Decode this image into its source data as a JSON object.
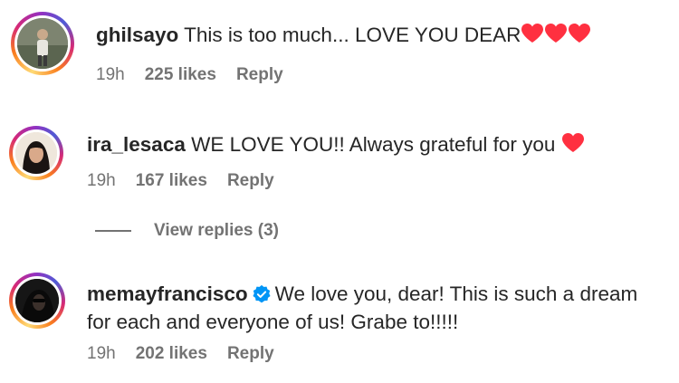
{
  "comments": [
    {
      "username": "ghilsayo",
      "text": "This is too much... LOVE YOU DEAR",
      "emoji": "❤️❤️❤️",
      "time": "19h",
      "likes": "225 likes",
      "reply": "Reply"
    },
    {
      "username": "ira_lesaca",
      "text": "WE LOVE YOU!! Always grateful for you",
      "emoji": "❤️",
      "time": "19h",
      "likes": "167 likes",
      "reply": "Reply"
    },
    {
      "username": "memayfrancisco",
      "verified": true,
      "text_line1": "We love you, dear! This is such a dream",
      "text_line2": "for each and everyone of us! Grabe to!!!!!",
      "time": "19h",
      "likes": "202 likes",
      "reply": "Reply"
    }
  ],
  "view_replies": "View replies (3)",
  "colors": {
    "text": "#262626",
    "meta": "#737373",
    "heart": "#ff3040",
    "verified": "#0095f6"
  }
}
